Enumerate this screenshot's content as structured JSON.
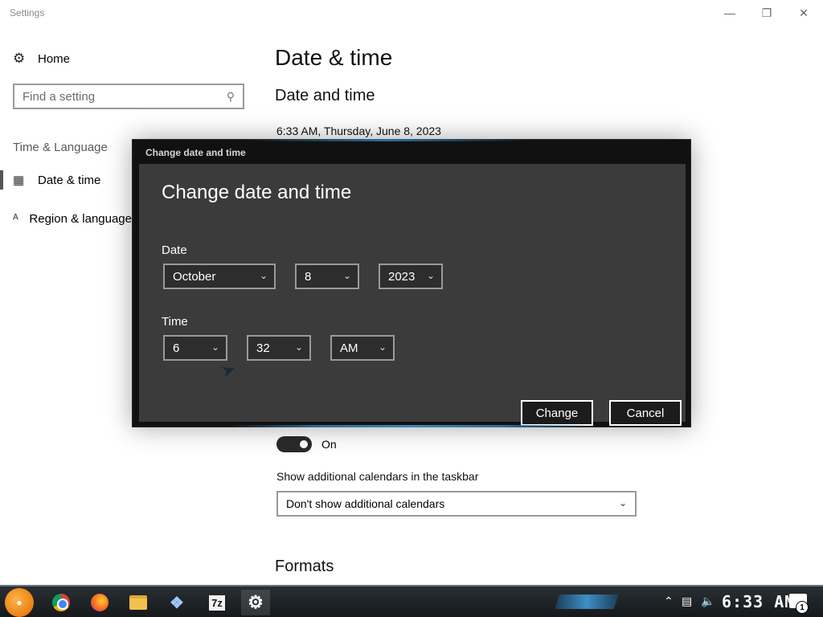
{
  "window": {
    "title": "Settings",
    "min_icon": "minimize-icon",
    "max_icon": "restore-icon",
    "close_icon": "close-icon"
  },
  "nav": {
    "home_label": "Home",
    "search_placeholder": "Find a setting",
    "section": "Time & Language",
    "items": [
      {
        "label": "Date & time",
        "icon": "calendar-clock-icon",
        "active": true
      },
      {
        "label": "Region & language",
        "icon": "language-icon",
        "active": false
      }
    ]
  },
  "main": {
    "title": "Date & time",
    "section_title": "Date and time",
    "current_datetime": "6:33 AM, Thursday, June 8, 2023",
    "toggle_label": "On",
    "toggle_on": true,
    "calendars_label": "Show additional calendars in the taskbar",
    "calendars_value": "Don't show additional calendars",
    "formats_title": "Formats"
  },
  "dialog": {
    "window_title": "Change date and time",
    "heading": "Change date and time",
    "date_label": "Date",
    "month": "October",
    "day": "8",
    "year": "2023",
    "time_label": "Time",
    "hour": "6",
    "minute": "32",
    "ampm": "AM",
    "change_label": "Change",
    "cancel_label": "Cancel"
  },
  "taskbar": {
    "start_icon": "start-orb-icon",
    "apps": [
      "chrome-icon",
      "firefox-icon",
      "file-explorer-icon",
      "virtualbox-icon",
      "7zip-icon",
      "settings-icon"
    ],
    "sevenzip_label": "7z",
    "clock": "6:33 AM",
    "notification_count": "1",
    "colors": {
      "accent": "#3d90c5"
    }
  }
}
